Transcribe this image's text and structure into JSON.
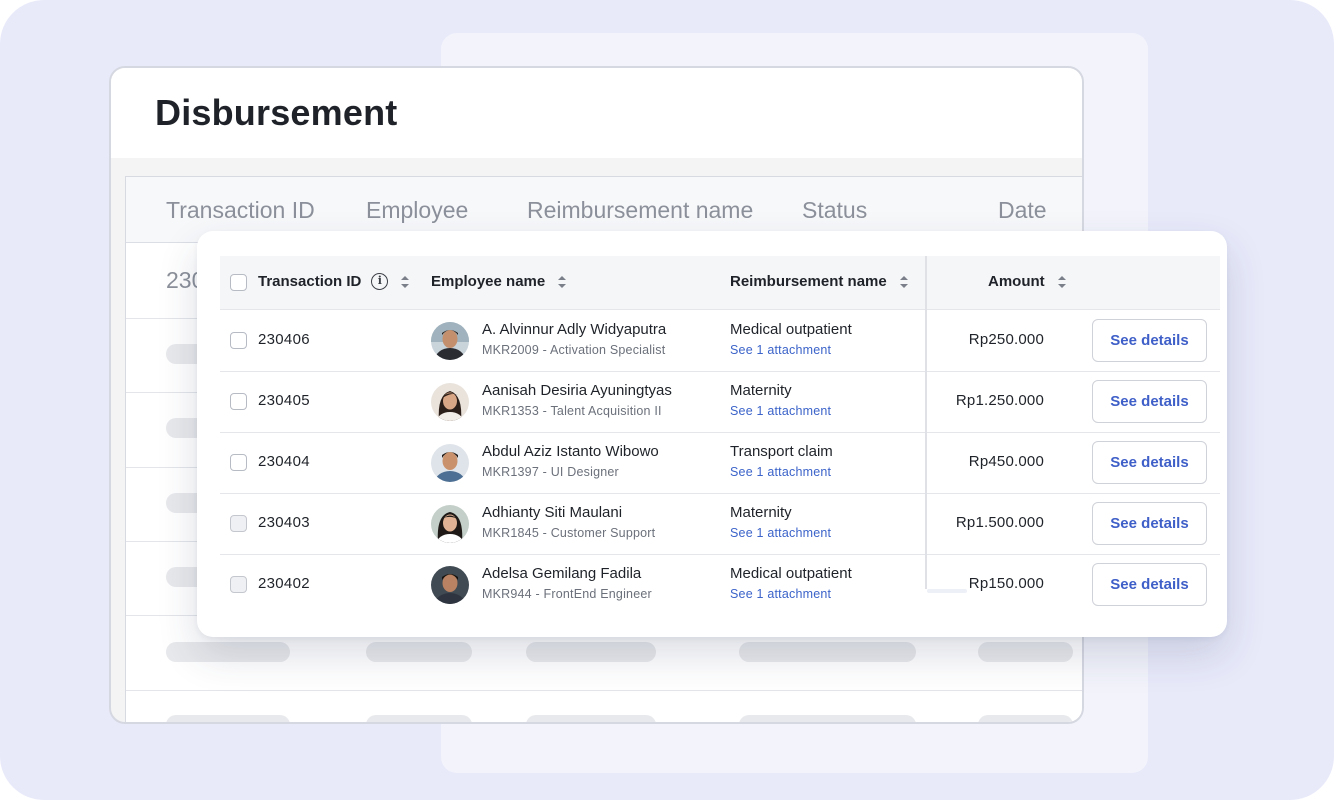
{
  "background_card": {
    "title": "Disbursement",
    "columns": [
      "Transaction ID",
      "Employee",
      "Reimbursement name",
      "Status",
      "Date"
    ],
    "first_cell_fragment": "230"
  },
  "table": {
    "headers": {
      "transaction_id": "Transaction ID",
      "info_glyph": "i",
      "employee_name": "Employee name",
      "reimbursement_name": "Reimbursement name",
      "amount": "Amount"
    },
    "rows": [
      {
        "id": "230406",
        "name": "A. Alvinnur Adly Widyaputra",
        "sub": "MKR2009 - Activation Specialist",
        "reimbursement": "Medical outpatient",
        "attachment": "See 1 attachment",
        "amount": "Rp250.000",
        "action": "See details"
      },
      {
        "id": "230405",
        "name": "Aanisah Desiria Ayuningtyas",
        "sub": "MKR1353 - Talent Acquisition II",
        "reimbursement": "Maternity",
        "attachment": "See 1 attachment",
        "amount": "Rp1.250.000",
        "action": "See details"
      },
      {
        "id": "230404",
        "name": "Abdul Aziz Istanto Wibowo",
        "sub": "MKR1397 - UI Designer",
        "reimbursement": "Transport claim",
        "attachment": "See 1 attachment",
        "amount": "Rp450.000",
        "action": "See details"
      },
      {
        "id": "230403",
        "name": "Adhianty Siti Maulani",
        "sub": "MKR1845 - Customer Support",
        "reimbursement": "Maternity",
        "attachment": "See 1 attachment",
        "amount": "Rp1.500.000",
        "action": "See details"
      },
      {
        "id": "230402",
        "name": "Adelsa Gemilang Fadila",
        "sub": "MKR944 - FrontEnd Engineer",
        "reimbursement": "Medical outpatient",
        "attachment": "See 1 attachment",
        "amount": "Rp150.000",
        "action": "See details"
      }
    ]
  },
  "colors": {
    "accent": "#3f5fc8",
    "link": "#3b63c9",
    "page_background": "#e8eafa"
  }
}
